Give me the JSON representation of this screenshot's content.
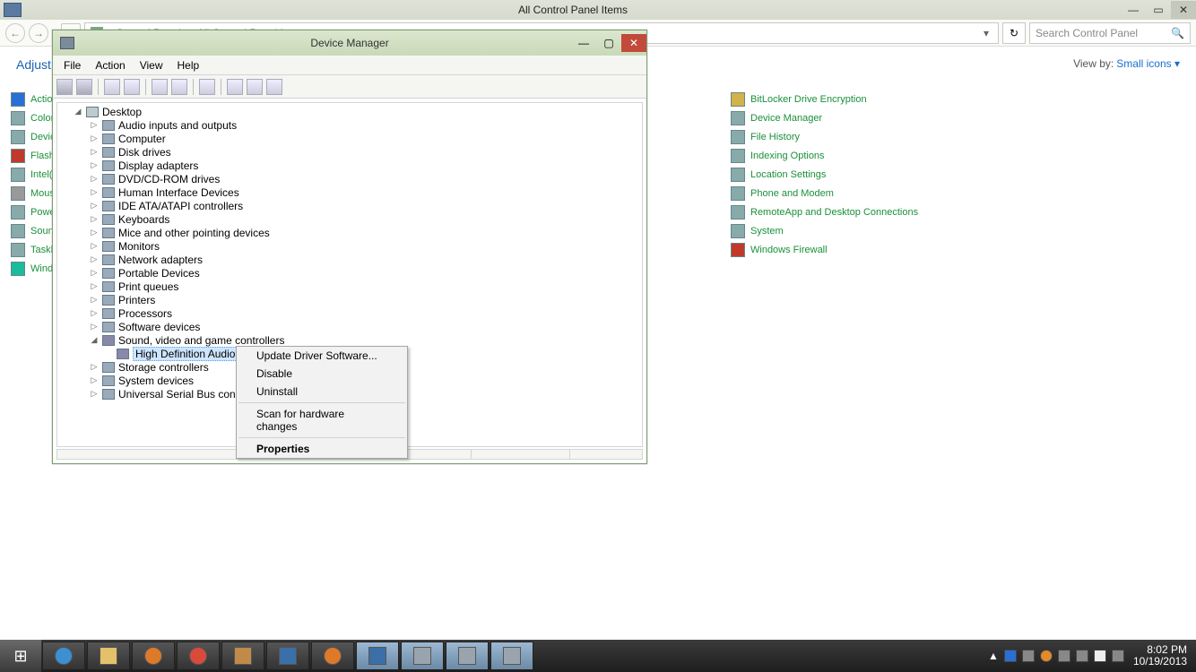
{
  "main_window": {
    "title": "All Control Panel Items",
    "btn_min": "—",
    "btn_max": "▭",
    "btn_close": "✕"
  },
  "nav": {
    "crumb1": "Control Panel",
    "crumb2": "All Control Panel Items",
    "dropdown": "▾",
    "refresh": "↻",
    "back": "←",
    "fwd": "→",
    "up": "▾"
  },
  "search": {
    "placeholder": "Search Control Panel",
    "icon": "🔍"
  },
  "cp": {
    "adjust": "Adjust y",
    "viewby_label": "View by:",
    "viewby_value": "Small icons ▾",
    "left_items": [
      "Action",
      "Color M",
      "Device",
      "Flash P",
      "Intel(R",
      "Mouse",
      "Power",
      "Sound",
      "Taskba",
      "Windo"
    ],
    "right_items": [
      "BitLocker Drive Encryption",
      "Device Manager",
      "File History",
      "Indexing Options",
      "Location Settings",
      "Phone and Modem",
      "RemoteApp and Desktop Connections",
      "System",
      "Windows Firewall"
    ]
  },
  "dm": {
    "title": "Device Manager",
    "menu": {
      "file": "File",
      "action": "Action",
      "view": "View",
      "help": "Help"
    },
    "btn_min": "—",
    "btn_max": "▢",
    "btn_close": "✕",
    "root": "Desktop",
    "nodes": [
      "Audio inputs and outputs",
      "Computer",
      "Disk drives",
      "Display adapters",
      "DVD/CD-ROM drives",
      "Human Interface Devices",
      "IDE ATA/ATAPI controllers",
      "Keyboards",
      "Mice and other pointing devices",
      "Monitors",
      "Network adapters",
      "Portable Devices",
      "Print queues",
      "Printers",
      "Processors",
      "Software devices"
    ],
    "sound_node": "Sound, video and game controllers",
    "selected": "High Definition Audio Device",
    "nodes_after": [
      "Storage controllers",
      "System devices",
      "Universal Serial Bus controllers"
    ]
  },
  "ctx": {
    "i1": "Update Driver Software...",
    "i2": "Disable",
    "i3": "Uninstall",
    "i4": "Scan for hardware changes",
    "i5": "Properties"
  },
  "taskbar": {
    "start": "⊞",
    "time": "8:02 PM",
    "date": "10/19/2013",
    "tray_up": "▲"
  }
}
